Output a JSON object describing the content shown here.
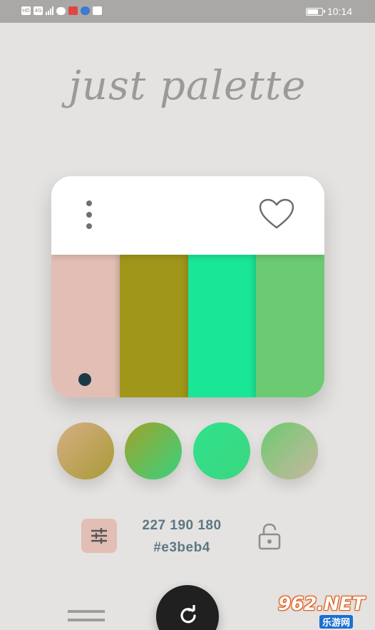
{
  "status_bar": {
    "left_badges": [
      "HD",
      "4G"
    ],
    "time": "10:14"
  },
  "app": {
    "title": "just palette"
  },
  "palette": {
    "colors": [
      "#e3beb4",
      "#a0961a",
      "#1ae697",
      "#6ccb72"
    ],
    "selected_index": 0,
    "selected_dot_color": "#1d3b47"
  },
  "gradients": [
    {
      "from": "#d6ae85",
      "to": "#a89b36"
    },
    {
      "from": "#9fa22b",
      "to": "#38d27f"
    },
    {
      "from": "#2fe28c",
      "to": "#3cd67f"
    },
    {
      "from": "#6ccb6f",
      "to": "#c8b7a0"
    }
  ],
  "color_info": {
    "rgb": "227 190 180",
    "hex": "#e3beb4",
    "text_color": "#5d7784",
    "adjust_button_color": "#e3beb4"
  },
  "watermark": {
    "main": "962.NET",
    "sub": "乐游网"
  }
}
